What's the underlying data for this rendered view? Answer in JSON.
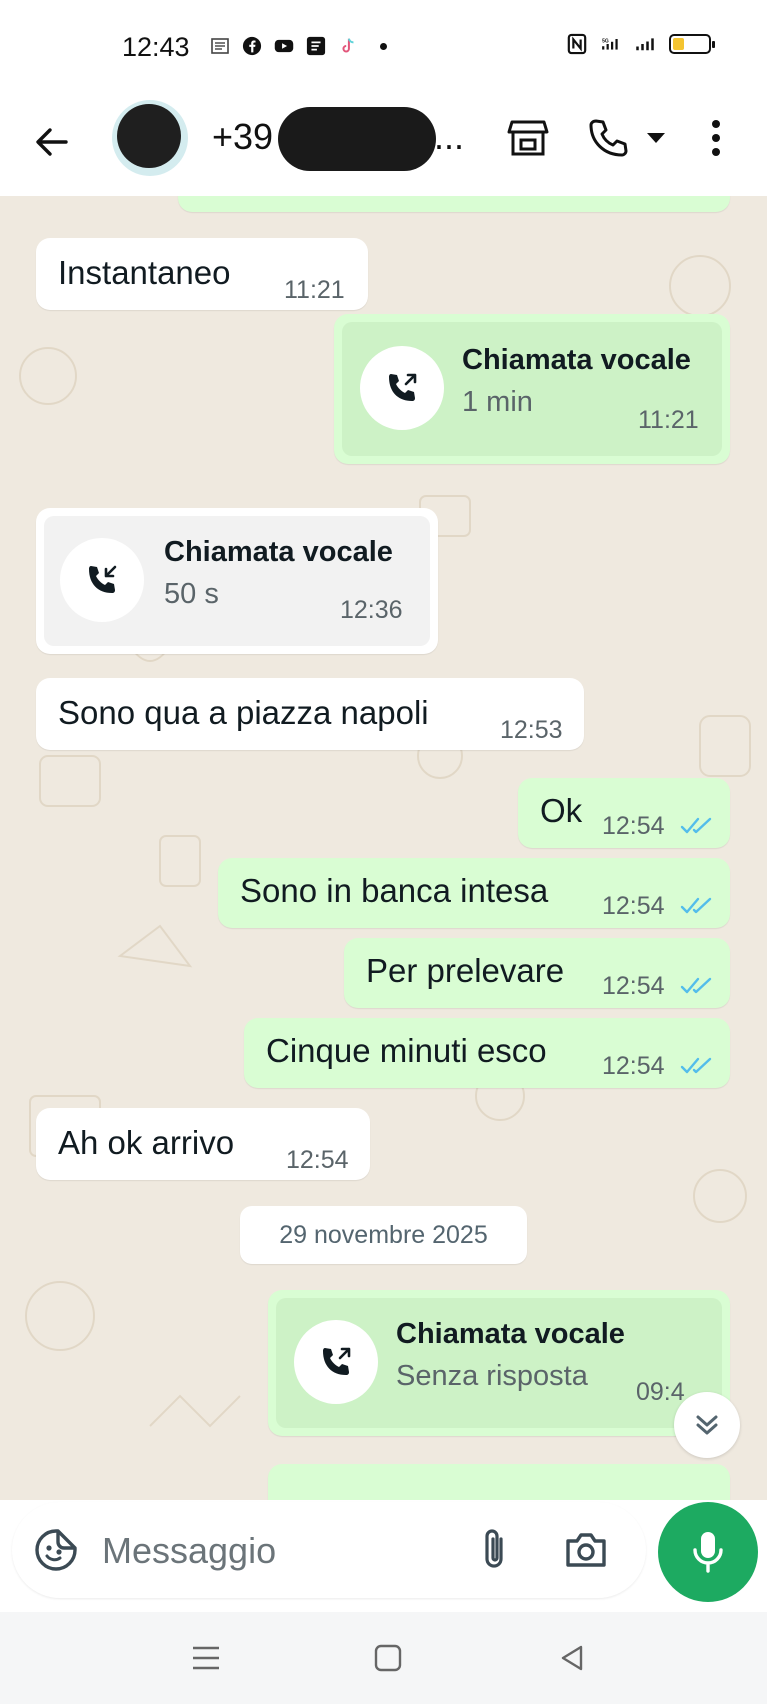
{
  "status_bar": {
    "time": "12:43",
    "icons_left": [
      "news-icon",
      "facebook-icon",
      "youtube-icon",
      "notes-icon",
      "tiktok-icon",
      "dot"
    ],
    "network": "5G",
    "battery_level": 0.3
  },
  "header": {
    "contact_name": "+39",
    "contact_ellipsis": "...",
    "icons": [
      "back-arrow-icon",
      "shop-icon",
      "phone-icon",
      "dropdown-icon",
      "more-vert-icon"
    ]
  },
  "messages": [
    {
      "kind": "text",
      "dir": "in",
      "text": "Instantaneo",
      "time": "11:21"
    },
    {
      "kind": "call",
      "dir": "out",
      "title": "Chiamata vocale",
      "subtitle": "1 min",
      "time": "11:21"
    },
    {
      "kind": "call",
      "dir": "in",
      "title": "Chiamata vocale",
      "subtitle": "50 s",
      "time": "12:36"
    },
    {
      "kind": "text",
      "dir": "in",
      "text": "Sono qua a piazza napoli",
      "time": "12:53"
    },
    {
      "kind": "text",
      "dir": "out",
      "text": "Ok",
      "time": "12:54",
      "status": "read"
    },
    {
      "kind": "text",
      "dir": "out",
      "text": "Sono in banca intesa",
      "time": "12:54",
      "status": "read"
    },
    {
      "kind": "text",
      "dir": "out",
      "text": "Per prelevare",
      "time": "12:54",
      "status": "read"
    },
    {
      "kind": "text",
      "dir": "out",
      "text": "Cinque minuti esco",
      "time": "12:54",
      "status": "read"
    },
    {
      "kind": "text",
      "dir": "in",
      "text": "Ah ok arrivo",
      "time": "12:54"
    },
    {
      "kind": "date",
      "text": "29 novembre 2025"
    },
    {
      "kind": "call",
      "dir": "out",
      "title": "Chiamata vocale",
      "subtitle": "Senza risposta",
      "time": "09:4"
    }
  ],
  "composer": {
    "placeholder": "Messaggio",
    "icons": [
      "sticker-icon",
      "attach-icon",
      "camera-icon",
      "mic-icon"
    ]
  },
  "colors": {
    "incoming_bubble": "#ffffff",
    "outgoing_bubble": "#d9fdd3",
    "chat_background": "#efe9df",
    "accent_green": "#1daa61",
    "read_ticks": "#53bdeb"
  },
  "nav_bar": {
    "icons": [
      "menu-icon",
      "home-icon",
      "back-icon"
    ]
  }
}
